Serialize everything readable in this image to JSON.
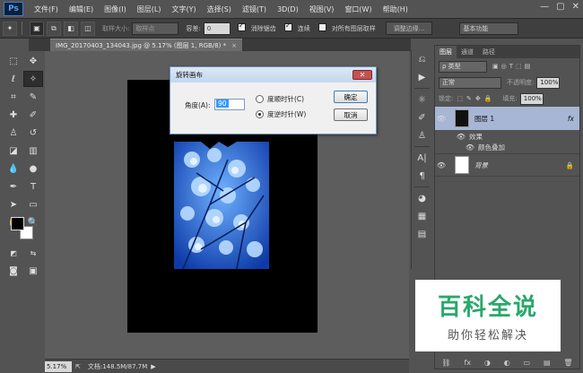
{
  "app": {
    "logo": "Ps"
  },
  "menu": [
    "文件(F)",
    "编辑(E)",
    "图像(I)",
    "图层(L)",
    "文字(Y)",
    "选择(S)",
    "滤镜(T)",
    "3D(D)",
    "视图(V)",
    "窗口(W)",
    "帮助(H)"
  ],
  "window_controls": {
    "minimize": "—",
    "restore": "▢",
    "close": "✕"
  },
  "options": {
    "sample_size_label": "取样大小:",
    "sample_size_value": "取样点",
    "tolerance_label": "容差:",
    "tolerance_value": "0",
    "anti_alias": "消除锯齿",
    "contiguous": "连续",
    "sample_all_layers": "对所有图层取样",
    "refine_edge": "调整边缘...",
    "workspace": "基本功能"
  },
  "document": {
    "tab_title": "IMG_20170403_134043.jpg @ 5.17% (图层 1, RGB/8) *",
    "tab_close": "×"
  },
  "dialog": {
    "title": "旋转画布",
    "close": "✕",
    "angle_label": "角度(A):",
    "angle_value": "90",
    "radio_cw": "度顺时针(C)",
    "radio_ccw": "度逆时针(W)",
    "selected": "ccw",
    "ok": "确定",
    "cancel": "取消"
  },
  "status": {
    "zoom": "5.17%",
    "doc_info": "文档:148.5M/87.7M",
    "arrow": "▶"
  },
  "layers_panel": {
    "tabs": [
      "图层",
      "通道",
      "路径"
    ],
    "kind_label": "ρ 类型",
    "blend_mode": "正常",
    "opacity_label": "不透明度:",
    "opacity_value": "100%",
    "lock_label": "锁定:",
    "fill_label": "填充:",
    "fill_value": "100%",
    "layers": [
      {
        "name": "图层 1",
        "fx": "fx",
        "effects_label": "效果",
        "effect": "颜色叠加"
      },
      {
        "name": "背景",
        "lock": "🔒"
      }
    ],
    "footer_icons": [
      "⛓",
      "fx",
      "◑",
      "◐",
      "▭",
      "▤",
      "🗑"
    ]
  },
  "watermark": {
    "title": "百科全说",
    "subtitle": "助你轻松解决"
  },
  "colors": {
    "selected_layer": "#a6b6d4",
    "photo_blue": "#1f5fd6",
    "dialog_bg": "#f0f0f0"
  }
}
